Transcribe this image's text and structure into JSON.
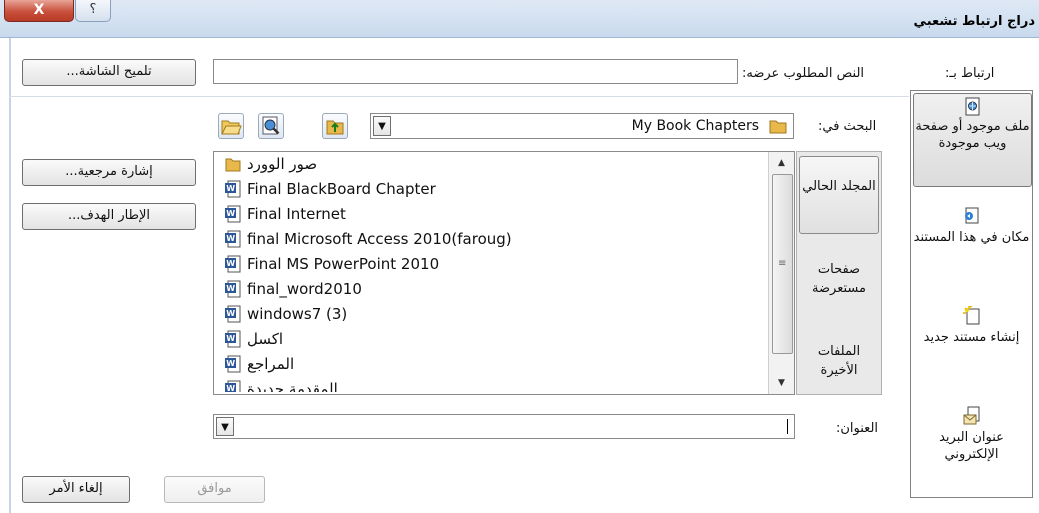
{
  "window": {
    "title": "دراج ارتباط تشعبي",
    "close_label": "X",
    "help_label": "؟"
  },
  "link_to": {
    "label": "ارتباط بـ:",
    "items": [
      "ملف موجود أو صفحة ويب موجودة",
      "مكان في هذا المستند",
      "إنشاء مستند جديد",
      "عنوان البريد الإلكتروني"
    ],
    "selected": 0
  },
  "text_to_display": {
    "label": "النص المطلوب عرضه:",
    "value": ""
  },
  "screentip_button": "تلميح الشاشة...",
  "look_in": {
    "label": "البحث في:",
    "value": "My Book Chapters"
  },
  "nav_tabs": [
    "المجلد الحالي",
    "صفحات مستعرضة",
    "الملفات الأخيرة"
  ],
  "files": [
    {
      "name": "صور الوورد",
      "type": "folder"
    },
    {
      "name": "Final BlackBoard Chapter",
      "type": "word"
    },
    {
      "name": "Final Internet",
      "type": "word"
    },
    {
      "name": "final Microsoft Access 2010(faroug)",
      "type": "word"
    },
    {
      "name": "Final MS PowerPoint 2010",
      "type": "word"
    },
    {
      "name": "final_word2010",
      "type": "word"
    },
    {
      "name": "windows7 (3)",
      "type": "word"
    },
    {
      "name": "اكسل",
      "type": "word"
    },
    {
      "name": "المراجع",
      "type": "word"
    },
    {
      "name": "المقدمة جديدة",
      "type": "word"
    }
  ],
  "bookmark_button": "إشارة مرجعية...",
  "target_frame_button": "الإطار الهدف...",
  "address": {
    "label": "العنوان:",
    "value": ""
  },
  "ok_button": "موافق",
  "cancel_button": "إلغاء الأمر",
  "colors": {
    "title_bar": "#c9daee",
    "close_button": "#c9503c",
    "word_icon": "#2b5797",
    "folder_icon": "#e8b84a"
  }
}
